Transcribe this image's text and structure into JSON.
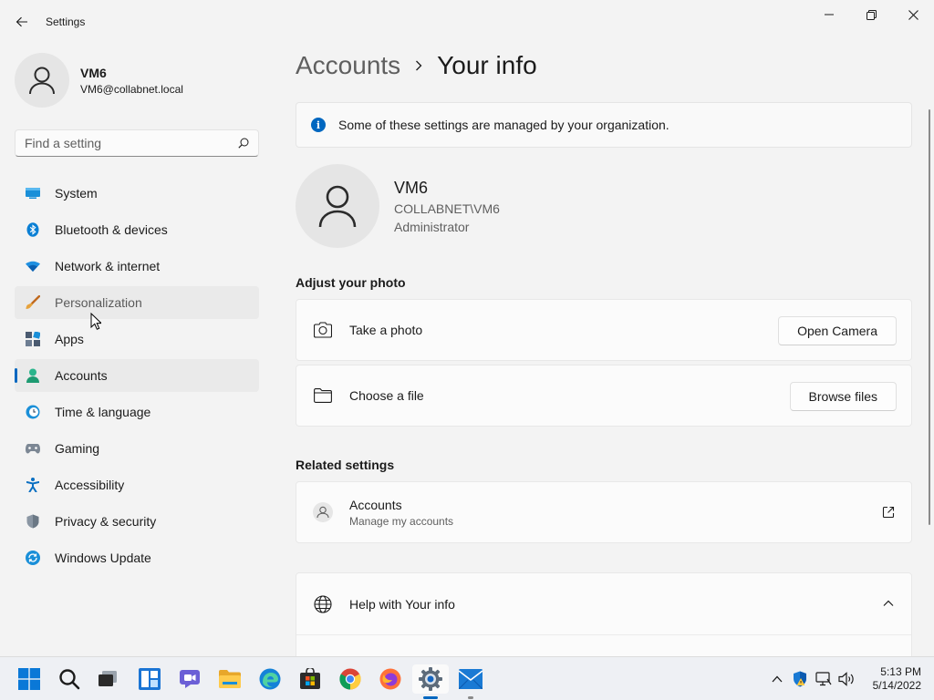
{
  "window": {
    "title": "Settings",
    "back_icon": "back-arrow-icon",
    "controls": [
      "minimize-icon",
      "maximize-icon",
      "close-icon"
    ]
  },
  "sidebar": {
    "profile": {
      "name": "VM6",
      "email": "VM6@collabnet.local"
    },
    "search": {
      "placeholder": "Find a setting",
      "value": ""
    },
    "items": [
      {
        "label": "System",
        "icon": "system-icon",
        "state": "normal"
      },
      {
        "label": "Bluetooth & devices",
        "icon": "bluetooth-icon",
        "state": "normal"
      },
      {
        "label": "Network & internet",
        "icon": "wifi-icon",
        "state": "normal"
      },
      {
        "label": "Personalization",
        "icon": "brush-icon",
        "state": "hover"
      },
      {
        "label": "Apps",
        "icon": "apps-icon",
        "state": "normal"
      },
      {
        "label": "Accounts",
        "icon": "accounts-icon",
        "state": "active"
      },
      {
        "label": "Time & language",
        "icon": "clock-globe-icon",
        "state": "normal"
      },
      {
        "label": "Gaming",
        "icon": "gamepad-icon",
        "state": "normal"
      },
      {
        "label": "Accessibility",
        "icon": "accessibility-icon",
        "state": "normal"
      },
      {
        "label": "Privacy & security",
        "icon": "shield-icon",
        "state": "normal"
      },
      {
        "label": "Windows Update",
        "icon": "update-icon",
        "state": "normal"
      }
    ]
  },
  "main": {
    "breadcrumb": {
      "parent": "Accounts",
      "current": "Your info"
    },
    "info_banner": "Some of these settings are managed by your organization.",
    "user": {
      "name": "VM6",
      "account": "COLLABNET\\VM6",
      "role": "Administrator"
    },
    "adjust_photo": {
      "title": "Adjust your photo",
      "take_photo": {
        "label": "Take a photo",
        "button": "Open Camera"
      },
      "choose_file": {
        "label": "Choose a file",
        "button": "Browse files"
      }
    },
    "related": {
      "title": "Related settings",
      "accounts": {
        "label": "Accounts",
        "sub": "Manage my accounts"
      }
    },
    "help": {
      "label": "Help with Your info"
    }
  },
  "taskbar": {
    "icons": [
      "start-icon",
      "search-icon",
      "task-view-icon",
      "widgets-icon",
      "teams-chat-icon",
      "file-explorer-icon",
      "edge-icon",
      "store-icon",
      "chrome-icon",
      "firefox-icon",
      "settings-icon",
      "mail-icon"
    ],
    "active": "settings-icon",
    "clock": {
      "time": "5:13 PM",
      "date": "5/14/2022"
    }
  },
  "colors": {
    "accent": "#0067c0",
    "background": "#f3f3f3",
    "card": "#fbfbfb"
  }
}
